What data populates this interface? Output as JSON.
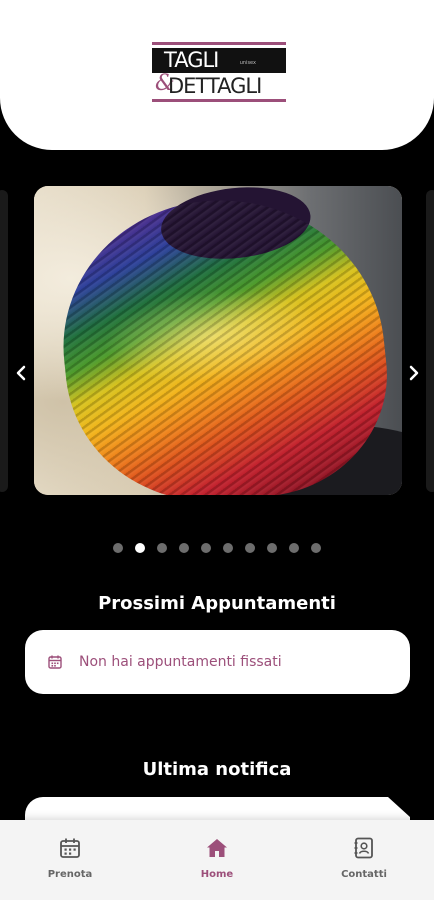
{
  "brand": {
    "line1": "TAGLI",
    "small_text": "unisex",
    "ampersand": "&",
    "line2": "DETTAGLI",
    "accent_color": "#9c4f7a"
  },
  "carousel": {
    "prev_icon": "chevron-left-icon",
    "next_icon": "chevron-right-icon",
    "slide_count": 10,
    "active_index": 1
  },
  "appointments": {
    "title": "Prossimi Appuntamenti",
    "icon": "calendar-icon",
    "empty_message": "Non hai appuntamenti fissati"
  },
  "notifications": {
    "title": "Ultima notifica"
  },
  "tabbar": {
    "items": [
      {
        "label": "Prenota",
        "icon": "calendar-icon",
        "active": false
      },
      {
        "label": "Home",
        "icon": "home-icon",
        "active": true
      },
      {
        "label": "Contatti",
        "icon": "contacts-book-icon",
        "active": false
      }
    ]
  }
}
